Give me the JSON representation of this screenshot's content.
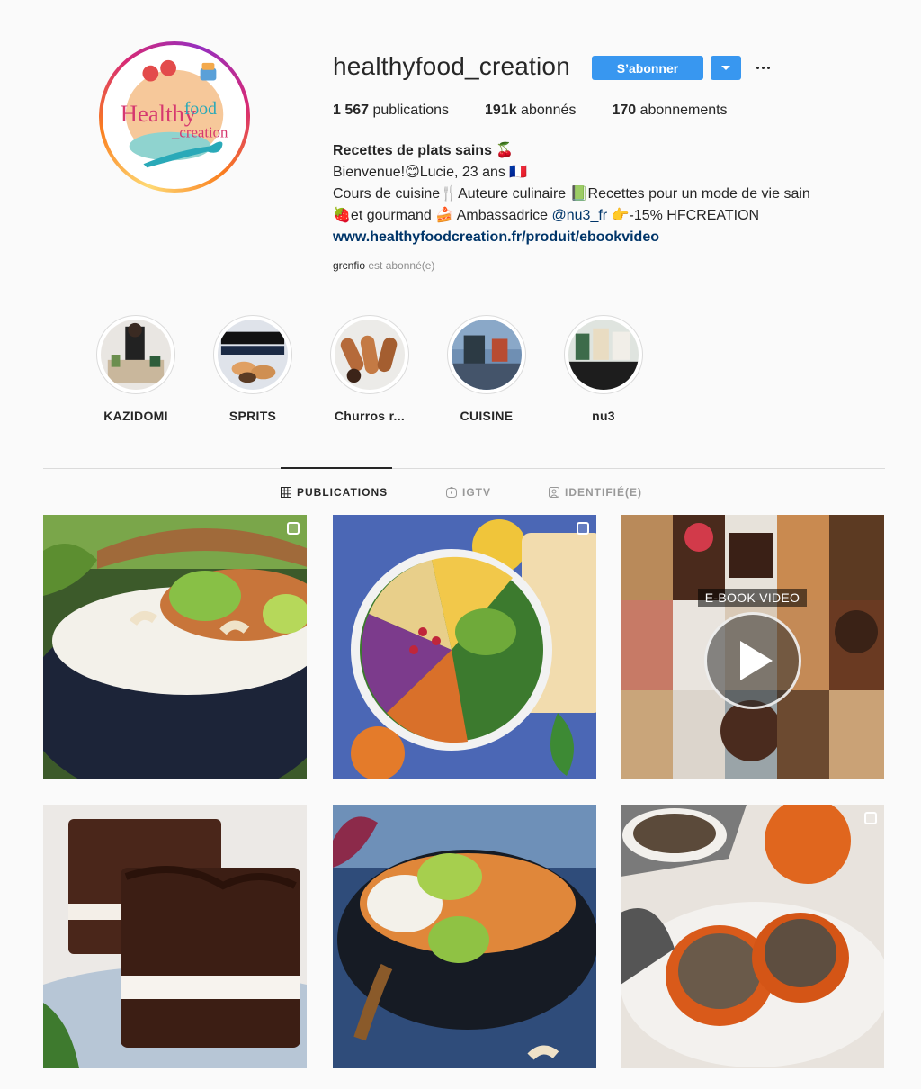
{
  "profile": {
    "username": "healthyfood_creation",
    "avatar_text_main": "Healthy",
    "avatar_text_accent": "food",
    "avatar_text_sub": "_creation",
    "follow_label": "S’abonner",
    "stats": [
      {
        "count": "1 567",
        "label": "publications"
      },
      {
        "count": "191k",
        "label": "abonnés"
      },
      {
        "count": "170",
        "label": "abonnements"
      }
    ],
    "bio": {
      "name": "Recettes de plats sains 🍒",
      "line1": "Bienvenue!😊Lucie, 23 ans 🇫🇷",
      "line2": "Cours de cuisine🍴Auteure culinaire 📗Recettes pour un mode de vie sain",
      "line3_pre": "🍓et gourmand 🍰 Ambassadrice ",
      "line3_mention": "@nu3_fr",
      "line3_post": " 👉-15% HFCREATION",
      "link": "www.healthyfoodcreation.fr/produit/ebookvideo"
    },
    "followed_by_user": "grcnfio",
    "followed_by_text": " est abonné(e)"
  },
  "highlights": [
    {
      "label": "KAZIDOMI"
    },
    {
      "label": "SPRITS"
    },
    {
      "label": "Churros r..."
    },
    {
      "label": "CUISINE"
    },
    {
      "label": "nu3"
    }
  ],
  "tabs": [
    {
      "label": "PUBLICATIONS",
      "icon": "grid-icon",
      "active": true
    },
    {
      "label": "IGTV",
      "icon": "igtv-icon",
      "active": false
    },
    {
      "label": "IDENTIFIÉ(E)",
      "icon": "tagged-icon",
      "active": false
    }
  ],
  "posts": {
    "ebook_label": "E-BOOK VIDEO"
  },
  "colors": {
    "accent": "#3897f0",
    "link": "#003569",
    "muted": "#8e8e8e"
  }
}
